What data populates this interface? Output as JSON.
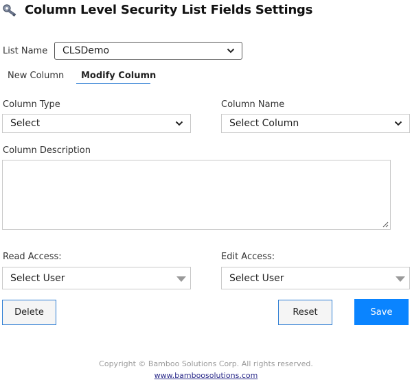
{
  "header": {
    "title": "Column Level Security List Fields Settings",
    "icon": "key-icon"
  },
  "list_name": {
    "label": "List Name",
    "value": "CLSDemo"
  },
  "tabs": [
    {
      "label": "New Column",
      "active": false
    },
    {
      "label": "Modify Column",
      "active": true
    }
  ],
  "form": {
    "column_type": {
      "label": "Column Type",
      "value": "Select"
    },
    "column_name": {
      "label": "Column Name",
      "value": "Select Column"
    },
    "column_description": {
      "label": "Column Description",
      "value": ""
    },
    "read_access": {
      "label": "Read Access:",
      "value": "Select User"
    },
    "edit_access": {
      "label": "Edit Access:",
      "value": "Select User"
    }
  },
  "buttons": {
    "delete": "Delete",
    "reset": "Reset",
    "save": "Save"
  },
  "footer": {
    "copyright": "Copyright © Bamboo Solutions Corp. All rights reserved.",
    "link": "www.bamboosolutions.com"
  },
  "colors": {
    "accent": "#0a84ff",
    "tab_underline": "#2b7cd3"
  }
}
